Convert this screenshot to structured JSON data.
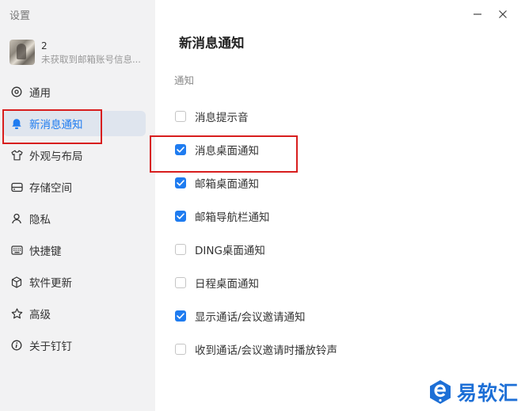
{
  "app": {
    "title": "设置"
  },
  "profile": {
    "name": "2",
    "subtitle": "未获取到邮箱账号信息..."
  },
  "sidebar": {
    "items": [
      {
        "label": "通用",
        "icon": "general-icon"
      },
      {
        "label": "新消息通知",
        "icon": "bell-icon",
        "active": true
      },
      {
        "label": "外观与布局",
        "icon": "shirt-icon"
      },
      {
        "label": "存储空间",
        "icon": "storage-icon"
      },
      {
        "label": "隐私",
        "icon": "person-icon"
      },
      {
        "label": "快捷键",
        "icon": "keyboard-icon"
      },
      {
        "label": "软件更新",
        "icon": "cube-icon"
      },
      {
        "label": "高级",
        "icon": "star-icon"
      },
      {
        "label": "关于钉钉",
        "icon": "info-icon"
      }
    ]
  },
  "main": {
    "title": "新消息通知",
    "section": "通知",
    "options": [
      {
        "label": "消息提示音",
        "checked": false
      },
      {
        "label": "消息桌面通知",
        "checked": true
      },
      {
        "label": "邮箱桌面通知",
        "checked": true
      },
      {
        "label": "邮箱导航栏通知",
        "checked": true
      },
      {
        "label": "DING桌面通知",
        "checked": false
      },
      {
        "label": "日程桌面通知",
        "checked": false
      },
      {
        "label": "显示通话/会议邀请通知",
        "checked": true
      },
      {
        "label": "收到通话/会议邀请时播放铃声",
        "checked": false
      }
    ]
  },
  "watermark": {
    "text": "易软汇"
  },
  "colors": {
    "accent": "#1f7cf0",
    "highlight": "#d81e1e",
    "sidebar_bg": "#f2f2f3",
    "active_bg": "#dfe5ee"
  }
}
